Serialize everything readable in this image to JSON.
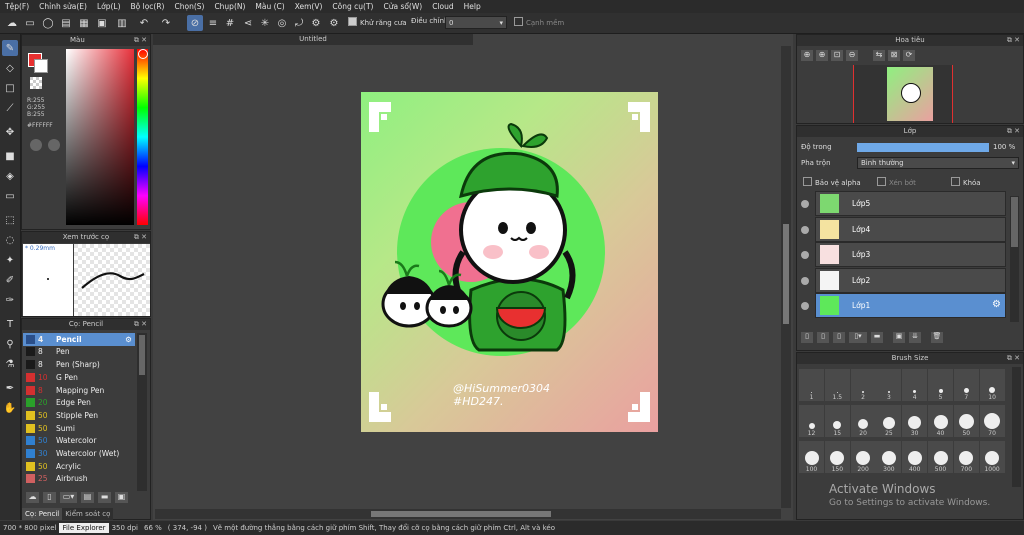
{
  "menu": [
    "Tệp(F)",
    "Chỉnh sửa(E)",
    "Lớp(L)",
    "Bộ lọc(R)",
    "Chọn(S)",
    "Chụp(N)",
    "Màu (C)",
    "Xem(V)",
    "Công cụ(T)",
    "Cửa sổ(W)",
    "Cloud",
    "Help"
  ],
  "toolbar": {
    "antialias_label": "Khử răng cưa",
    "adjust_label": "Điều chỉnh",
    "adjust_value": "0",
    "snap_label": "Cạnh mềm"
  },
  "color_panel": {
    "title": "Màu",
    "r": "R:255",
    "g": "G:255",
    "b": "B:255",
    "hex": "#FFFFFF"
  },
  "preview_panel": {
    "title": "Xem trước cọ",
    "size": "* 0.29mm"
  },
  "brush_panel": {
    "title": "Cọ: Pencil",
    "items": [
      {
        "size": "4",
        "name": "Pencil",
        "color": "#2a4f8a",
        "selected": true
      },
      {
        "size": "8",
        "name": "Pen",
        "color": "#1a1a1a",
        "selected": false
      },
      {
        "size": "8",
        "name": "Pen (Sharp)",
        "color": "#1a1a1a",
        "selected": false
      },
      {
        "size": "10",
        "name": "G Pen",
        "color": "#d43030",
        "selected": false
      },
      {
        "size": "8",
        "name": "Mapping Pen",
        "color": "#d43030",
        "selected": false
      },
      {
        "size": "20",
        "name": "Edge Pen",
        "color": "#2aa02a",
        "selected": false
      },
      {
        "size": "50",
        "name": "Stipple Pen",
        "color": "#e0c020",
        "selected": false
      },
      {
        "size": "50",
        "name": "Sumi",
        "color": "#e0c020",
        "selected": false
      },
      {
        "size": "50",
        "name": "Watercolor",
        "color": "#3080d0",
        "selected": false
      },
      {
        "size": "30",
        "name": "Watercolor (Wet)",
        "color": "#3080d0",
        "selected": false
      },
      {
        "size": "50",
        "name": "Acrylic",
        "color": "#e0c020",
        "selected": false
      },
      {
        "size": "25",
        "name": "Airbrush",
        "color": "#d06060",
        "selected": false
      }
    ],
    "tab1": "Cọ: Pencil",
    "tab2": "Kiểm soát cọ"
  },
  "document": {
    "tab_title": "Untitled",
    "signature_line1": "@HiSummer0304",
    "signature_line2": "#HD247."
  },
  "navigator": {
    "title": "Hoa tiêu"
  },
  "layer_panel": {
    "title": "Lớp",
    "opacity_label": "Độ trong",
    "opacity_value": "100 %",
    "opacity_fraction": 1.0,
    "blend_label": "Pha trộn",
    "blend_value": "Bình thường",
    "protect_alpha": "Bảo vệ alpha",
    "clipping": "Xén bớt",
    "lock": "Khóa",
    "layers": [
      {
        "name": "Lớp5",
        "selected": false
      },
      {
        "name": "Lớp4",
        "selected": false
      },
      {
        "name": "Lớp3",
        "selected": false
      },
      {
        "name": "Lớp2",
        "selected": false
      },
      {
        "name": "Lớp1",
        "selected": true
      }
    ]
  },
  "brush_size_panel": {
    "title": "Brush Size",
    "sizes": [
      "1",
      "1.5",
      "2",
      "3",
      "4",
      "5",
      "7",
      "10",
      "12",
      "15",
      "20",
      "25",
      "30",
      "40",
      "50",
      "70",
      "100",
      "150",
      "200",
      "300",
      "400",
      "500",
      "700",
      "1000"
    ]
  },
  "status": {
    "dims": "700 * 800 pixel",
    "file_explorer": "File Explorer",
    "dpi": "350 dpi",
    "zoom": "66 %",
    "coords": "( 374, -94 )",
    "hint": "Vẽ một đường thẳng bằng cách giữ phím Shift, Thay đổi cỡ cọ bằng cách giữ phím Ctrl, Alt và kéo"
  },
  "watermark": {
    "line1": "Activate Windows",
    "line2": "Go to Settings to activate Windows."
  },
  "colors": {
    "accent": "#5a8fd0",
    "bg": "#3a3a3a"
  }
}
